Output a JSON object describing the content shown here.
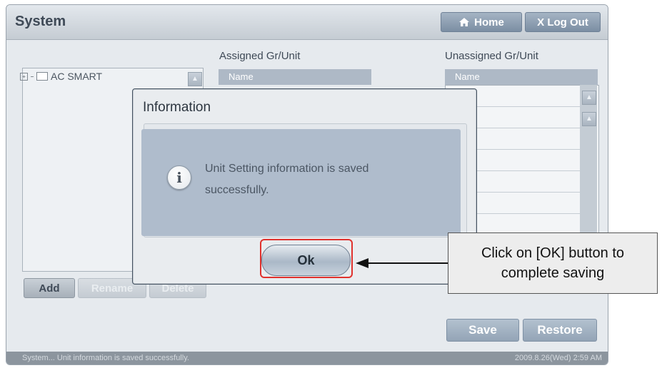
{
  "header": {
    "title": "System",
    "home_label": "Home",
    "logout_label": "X Log Out"
  },
  "tree": {
    "root_label": "AC SMART"
  },
  "assigned": {
    "heading": "Assigned Gr/Unit",
    "column": "Name"
  },
  "unassigned": {
    "heading": "Unassigned Gr/Unit",
    "column": "Name"
  },
  "tree_buttons": {
    "add": "Add",
    "rename": "Rename",
    "delete": "Delete"
  },
  "bottom_buttons": {
    "save": "Save",
    "restore": "Restore"
  },
  "status": {
    "message": "System... Unit information is saved successfully.",
    "datetime": "2009.8.26(Wed)  2:59 AM"
  },
  "dialog": {
    "title": "Information",
    "message_line1": "Unit Setting information is saved",
    "message_line2": "successfully.",
    "ok_label": "Ok"
  },
  "callout": {
    "line1": "Click on [OK] button to",
    "line2": "complete saving"
  },
  "colors": {
    "highlight": "#e0322e",
    "header_blue": "#aeb9c6"
  },
  "icons": [
    "home-icon",
    "info-icon",
    "scroll-up-icon",
    "tree-expand-icon",
    "folder-icon"
  ]
}
